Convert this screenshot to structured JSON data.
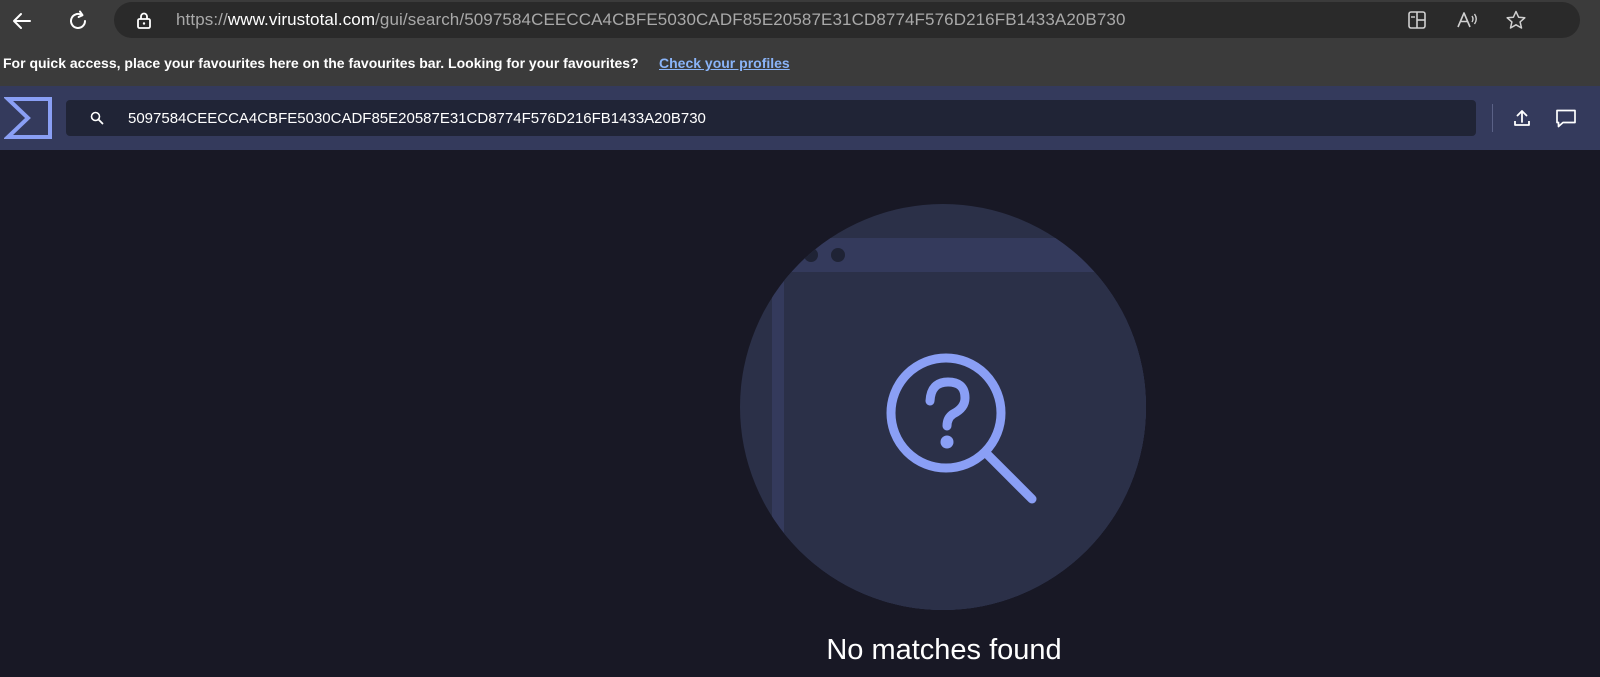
{
  "browser": {
    "url_scheme": "https://",
    "url_host": "www.virustotal.com",
    "url_path": "/gui/search/5097584CEECCA4CBFE5030CADF85E20587E31CD8774F576D216FB1433A20B730",
    "icons": {
      "back": "back-arrow-icon",
      "refresh": "refresh-icon",
      "lock": "lock-icon",
      "split_screen": "split-screen-icon",
      "read_aloud": "read-aloud-icon",
      "favourite": "star-icon"
    }
  },
  "favourites_bar": {
    "message": "For quick access, place your favourites here on the favourites bar. Looking for your favourites?",
    "link_label": "Check your profiles"
  },
  "vt_header": {
    "logo": "virustotal-sigma-logo",
    "search_value": "5097584CEECCA4CBFE5030CADF85E20587E31CD8774F576D216FB1433A20B730",
    "icons": {
      "search": "search-icon",
      "upload": "upload-icon",
      "chat": "chat-icon"
    }
  },
  "main": {
    "empty_state_icon": "question-magnifier-icon",
    "empty_state_text": "No matches found"
  },
  "colors": {
    "page_background": "#181825",
    "header_background": "#343a5c",
    "search_background": "#202436",
    "accent": "#8a9ff5",
    "illustration_circle": "#2b3048",
    "browser_chrome": "#3b3b3b",
    "link": "#8ab4f8"
  }
}
